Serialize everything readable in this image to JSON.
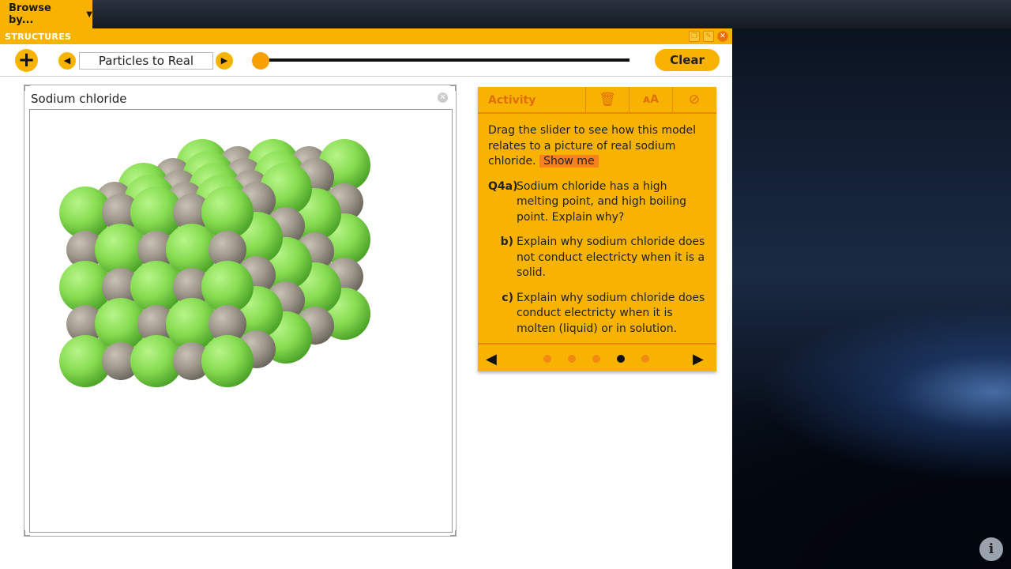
{
  "app": {
    "browse_label": "Browse by...",
    "window_title": "STRUCTURES"
  },
  "toolbar": {
    "add_label": "+",
    "prev_label": "◀",
    "next_label": "▶",
    "model_title": "Particles to Real",
    "slider_value": 0,
    "clear_label": "Clear"
  },
  "model": {
    "title": "Sodium chloride",
    "colors": {
      "chloride": "#8ee05a",
      "sodium": "#a09a8c"
    }
  },
  "activity": {
    "title": "Activity",
    "intro": "Drag the slider to see how this model relates to a picture of real sodium chloride.",
    "show_me": "Show me",
    "questions": [
      {
        "label": "Q4a)",
        "text": "Sodium chloride has a high melting point, and high boiling point. Explain why?"
      },
      {
        "label": "b)",
        "text": "Explain why sodium chloride does not conduct electricty when it is a solid."
      },
      {
        "label": "c)",
        "text": "Explain why sodium chloride does conduct electricty when it is molten (liquid) or in solution."
      }
    ],
    "page_count": 5,
    "current_page": 4
  },
  "colors": {
    "accent": "#f7b300",
    "accent_dark": "#e06f00"
  }
}
